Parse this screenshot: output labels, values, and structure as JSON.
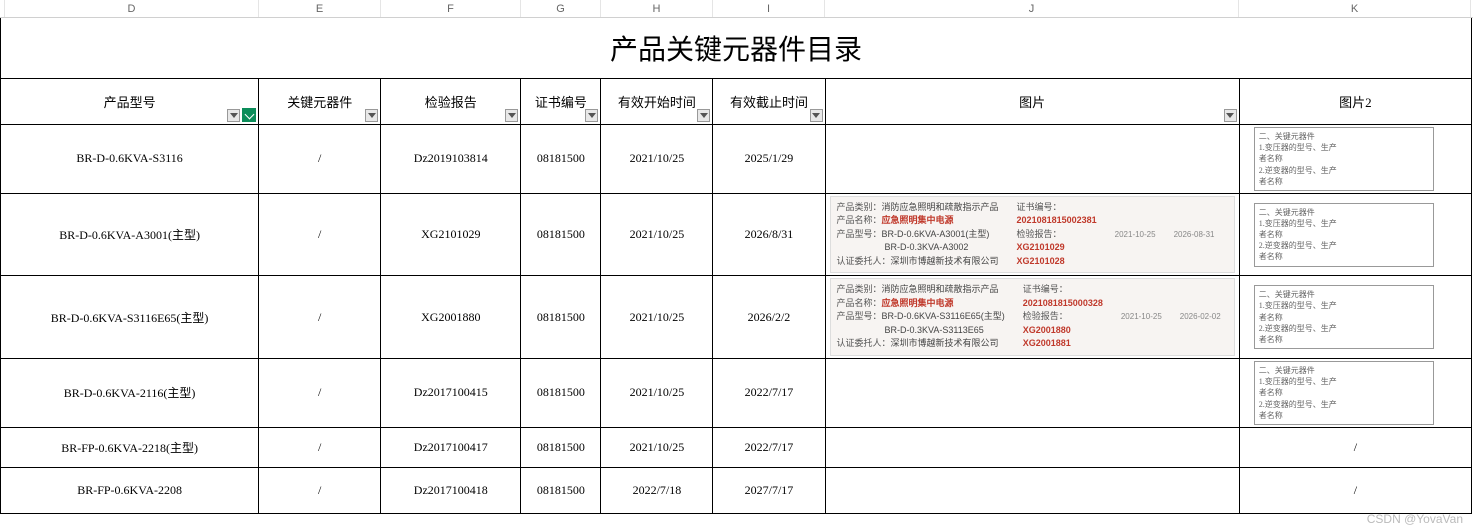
{
  "columns": {
    "D": "D",
    "E": "E",
    "F": "F",
    "G": "G",
    "H": "H",
    "I": "I",
    "J": "J",
    "K": "K"
  },
  "title": "产品关键元器件目录",
  "headers": {
    "model": "产品型号",
    "key_component": "关键元器件",
    "inspection_report": "检验报告",
    "cert_no": "证书编号",
    "valid_start": "有效开始时间",
    "valid_end": "有效截止时间",
    "image": "图片",
    "image2": "图片2"
  },
  "rows": [
    {
      "model": "BR-D-0.6KVA-S3116",
      "key_component": "/",
      "inspection_report": "Dz2019103814",
      "cert_no": "08181500",
      "valid_start": "2021/10/25",
      "valid_end": "2025/1/29",
      "card": null,
      "mini": {
        "title": "二、关键元器件",
        "l1": "1.变压器的型号、生产",
        "l2": "者名称",
        "l3": "2.逆变器的型号、生产",
        "l4": "者名称"
      }
    },
    {
      "model": "BR-D-0.6KVA-A3001(主型)",
      "key_component": "/",
      "inspection_report": "XG2101029",
      "cert_no": "08181500",
      "valid_start": "2021/10/25",
      "valid_end": "2026/8/31",
      "card": {
        "p_cat_lbl": "产品类别：",
        "p_cat": "消防应急照明和疏散指示产品",
        "p_name_lbl": "产品名称：",
        "p_name": "应急照明集中电源",
        "p_model_lbl": "产品型号：",
        "p_model": "BR-D-0.6KVA-A3001(主型)",
        "p_model2": "BR-D-0.3KVA-A3002",
        "p_ent_lbl": "认证委托人：",
        "p_ent": "深圳市博越新技术有限公司",
        "cert_lbl": "证书编号：",
        "cert": "2021081815002381",
        "rep_lbl": "检验报告：",
        "rep1": "XG2101029",
        "rep2": "XG2101028",
        "d1": "2021-10-25",
        "d2": "2026-08-31"
      },
      "mini": {
        "title": "二、关键元器件",
        "l1": "1.变压器的型号、生产",
        "l2": "者名称",
        "l3": "2.逆变器的型号、生产",
        "l4": "者名称"
      }
    },
    {
      "model": "BR-D-0.6KVA-S3116E65(主型)",
      "key_component": "/",
      "inspection_report": "XG2001880",
      "cert_no": "08181500",
      "valid_start": "2021/10/25",
      "valid_end": "2026/2/2",
      "card": {
        "p_cat_lbl": "产品类别：",
        "p_cat": "消防应急照明和疏散指示产品",
        "p_name_lbl": "产品名称：",
        "p_name": "应急照明集中电源",
        "p_model_lbl": "产品型号：",
        "p_model": "BR-D-0.6KVA-S3116E65(主型)",
        "p_model2": "BR-D-0.3KVA-S3113E65",
        "p_ent_lbl": "认证委托人：",
        "p_ent": "深圳市博越新技术有限公司",
        "cert_lbl": "证书编号：",
        "cert": "2021081815000328",
        "rep_lbl": "检验报告：",
        "rep1": "XG2001880",
        "rep2": "XG2001881",
        "d1": "2021-10-25",
        "d2": "2026-02-02"
      },
      "mini": {
        "title": "二、关键元器件",
        "l1": "1.变压器的型号、生产",
        "l2": "者名称",
        "l3": "2.逆变器的型号、生产",
        "l4": "者名称"
      }
    },
    {
      "model": "BR-D-0.6KVA-2116(主型)",
      "key_component": "/",
      "inspection_report": "Dz2017100415",
      "cert_no": "08181500",
      "valid_start": "2021/10/25",
      "valid_end": "2022/7/17",
      "card": null,
      "mini": {
        "title": "二、关键元器件",
        "l1": "1.变压器的型号、生产",
        "l2": "者名称",
        "l3": "2.逆变器的型号、生产",
        "l4": "者名称"
      }
    },
    {
      "model": "BR-FP-0.6KVA-2218(主型)",
      "key_component": "/",
      "inspection_report": "Dz2017100417",
      "cert_no": "08181500",
      "valid_start": "2021/10/25",
      "valid_end": "2022/7/17",
      "card": null,
      "mini_text": "/"
    },
    {
      "model": "BR-FP-0.6KVA-2208",
      "key_component": "/",
      "inspection_report": "Dz2017100418",
      "cert_no": "08181500",
      "valid_start": "2022/7/18",
      "valid_end": "2027/7/17",
      "card": null,
      "mini_text": "/"
    }
  ],
  "watermark": "CSDN @YovaVan"
}
